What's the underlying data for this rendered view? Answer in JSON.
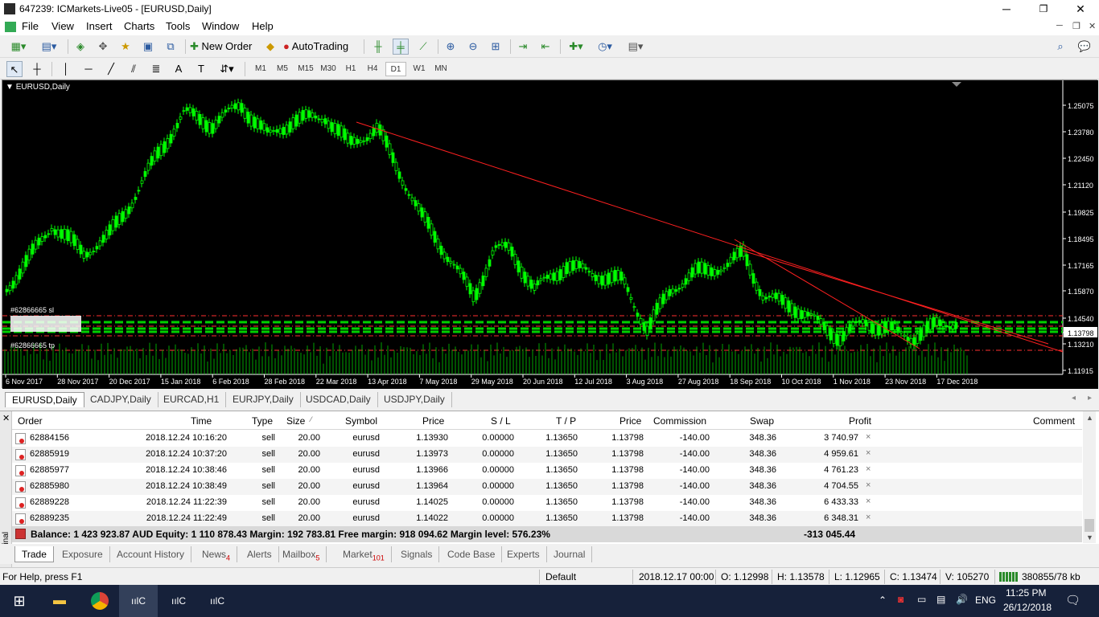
{
  "window": {
    "title": "647239: ICMarkets-Live05 - [EURUSD,Daily]",
    "minimize": "─",
    "maximize": "❐",
    "close": "✕"
  },
  "menu": {
    "items": [
      "File",
      "View",
      "Insert",
      "Charts",
      "Tools",
      "Window",
      "Help"
    ]
  },
  "toolbar": {
    "new_order": "New Order",
    "autotrading": "AutoTrading"
  },
  "timeframes": [
    "M1",
    "M5",
    "M15",
    "M30",
    "H1",
    "H4",
    "D1",
    "W1",
    "MN"
  ],
  "selected_timeframe": "D1",
  "chart": {
    "label": "EURUSD,Daily",
    "price_labels": [
      "1.25075",
      "1.23780",
      "1.22450",
      "1.21120",
      "1.19825",
      "1.18495",
      "1.17165",
      "1.15870",
      "1.14540",
      "1.13798",
      "1.13210",
      "1.11915"
    ],
    "current_price": "1.13798",
    "date_labels": [
      "6 Nov 2017",
      "28 Nov 2017",
      "20 Dec 2017",
      "15 Jan 2018",
      "6 Feb 2018",
      "28 Feb 2018",
      "22 Mar 2018",
      "13 Apr 2018",
      "7 May 2018",
      "29 May 2018",
      "20 Jun 2018",
      "12 Jul 2018",
      "3 Aug 2018",
      "27 Aug 2018",
      "18 Sep 2018",
      "10 Oct 2018",
      "1 Nov 2018",
      "23 Nov 2018",
      "17 Dec 2018"
    ],
    "sl_label": "#62866665 sl",
    "tp_label": "#62866665 tp",
    "bull_color": "#00ff00",
    "line_color": "#ff2020"
  },
  "chart_tabs": [
    "EURUSD,Daily",
    "CADJPY,Daily",
    "EURCAD,H1",
    "EURJPY,Daily",
    "USDCAD,Daily",
    "USDJPY,Daily"
  ],
  "terminal": {
    "side_label": "Terminal",
    "headers": [
      "Order",
      "Time",
      "Type",
      "Size",
      "Symbol",
      "Price",
      "S / L",
      "T / P",
      "Price",
      "Commission",
      "Swap",
      "Profit",
      "Comment"
    ],
    "size_sort": "⁄",
    "rows": [
      {
        "order": "62884156",
        "time": "2018.12.24 10:16:20",
        "type": "sell",
        "size": "20.00",
        "symbol": "eurusd",
        "price": "1.13930",
        "sl": "0.00000",
        "tp": "1.13650",
        "cur": "1.13798",
        "commission": "-140.00",
        "swap": "348.36",
        "profit": "3 740.97"
      },
      {
        "order": "62885919",
        "time": "2018.12.24 10:37:20",
        "type": "sell",
        "size": "20.00",
        "symbol": "eurusd",
        "price": "1.13973",
        "sl": "0.00000",
        "tp": "1.13650",
        "cur": "1.13798",
        "commission": "-140.00",
        "swap": "348.36",
        "profit": "4 959.61"
      },
      {
        "order": "62885977",
        "time": "2018.12.24 10:38:46",
        "type": "sell",
        "size": "20.00",
        "symbol": "eurusd",
        "price": "1.13966",
        "sl": "0.00000",
        "tp": "1.13650",
        "cur": "1.13798",
        "commission": "-140.00",
        "swap": "348.36",
        "profit": "4 761.23"
      },
      {
        "order": "62885980",
        "time": "2018.12.24 10:38:49",
        "type": "sell",
        "size": "20.00",
        "symbol": "eurusd",
        "price": "1.13964",
        "sl": "0.00000",
        "tp": "1.13650",
        "cur": "1.13798",
        "commission": "-140.00",
        "swap": "348.36",
        "profit": "4 704.55"
      },
      {
        "order": "62889228",
        "time": "2018.12.24 11:22:39",
        "type": "sell",
        "size": "20.00",
        "symbol": "eurusd",
        "price": "1.14025",
        "sl": "0.00000",
        "tp": "1.13650",
        "cur": "1.13798",
        "commission": "-140.00",
        "swap": "348.36",
        "profit": "6 433.33"
      },
      {
        "order": "62889235",
        "time": "2018.12.24 11:22:49",
        "type": "sell",
        "size": "20.00",
        "symbol": "eurusd",
        "price": "1.14022",
        "sl": "0.00000",
        "tp": "1.13650",
        "cur": "1.13798",
        "commission": "-140.00",
        "swap": "348.36",
        "profit": "6 348.31"
      }
    ],
    "balance_line": "Balance: 1 423 923.87 AUD  Equity: 1 110 878.43  Margin: 192 783.81  Free margin: 918 094.62  Margin level: 576.23%",
    "total_profit": "-313 045.44",
    "close_glyph": "×"
  },
  "terminal_tabs": [
    {
      "label": "Trade",
      "badge": ""
    },
    {
      "label": "Exposure",
      "badge": ""
    },
    {
      "label": "Account History",
      "badge": ""
    },
    {
      "label": "News",
      "badge": "4"
    },
    {
      "label": "Alerts",
      "badge": ""
    },
    {
      "label": "Mailbox",
      "badge": "5"
    },
    {
      "label": "Market",
      "badge": "101"
    },
    {
      "label": "Signals",
      "badge": ""
    },
    {
      "label": "Code Base",
      "badge": ""
    },
    {
      "label": "Experts",
      "badge": ""
    },
    {
      "label": "Journal",
      "badge": ""
    }
  ],
  "status": {
    "help": "For Help, press F1",
    "profile": "Default",
    "datetime": "2018.12.17 00:00",
    "open": "O: 1.12998",
    "high": "H: 1.13578",
    "low": "L: 1.12965",
    "close": "C: 1.13474",
    "volume": "V: 105270",
    "traffic": "380855/78 kb"
  },
  "taskbar": {
    "lang": "ENG",
    "time": "11:25 PM",
    "date": "26/12/2018"
  }
}
